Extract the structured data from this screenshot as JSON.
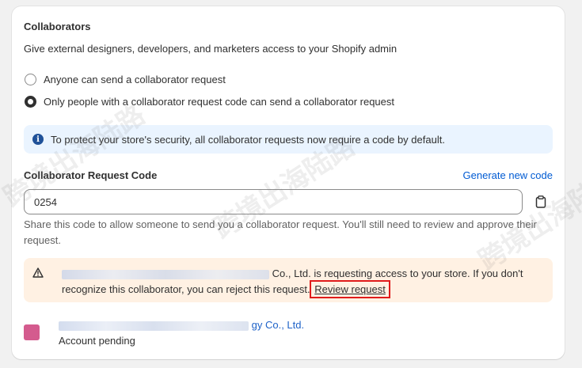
{
  "section": {
    "title": "Collaborators",
    "description": "Give external designers, developers, and marketers access to your Shopify admin"
  },
  "options": [
    {
      "label": "Anyone can send a collaborator request",
      "checked": false
    },
    {
      "label": "Only people with a collaborator request code can send a collaborator request",
      "checked": true
    }
  ],
  "banner": {
    "text": "To protect your store's security, all collaborator requests now require a code by default."
  },
  "code": {
    "label": "Collaborator Request Code",
    "generate_label": "Generate new code",
    "value": "0254",
    "help": "Share this code to allow someone to send you a collaborator request. You'll still need to review and approve their request."
  },
  "request_warning": {
    "text_after_name": "Co., Ltd. is requesting access to your store. If you don't recognize this collaborator, you can reject this request.",
    "review_label": "Review request"
  },
  "collaborator": {
    "name_suffix": "gy Co., Ltd.",
    "status": "Account pending",
    "thumb_color": "#d45b8e"
  },
  "watermark": {
    "text": "跨境出海陆路"
  },
  "colors": {
    "link": "#005bd3",
    "info_banner": "#eaf4ff",
    "warning_banner": "#fff1e3",
    "highlight": "#e01b1b"
  }
}
